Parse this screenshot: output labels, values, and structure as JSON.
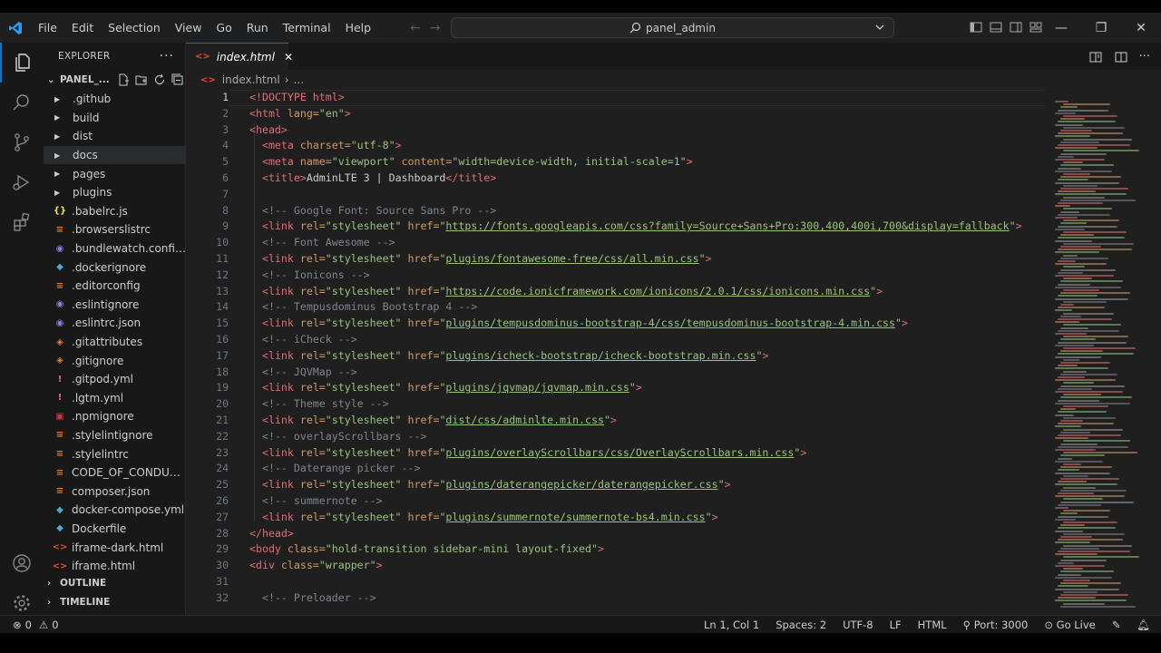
{
  "menu": [
    "File",
    "Edit",
    "Selection",
    "View",
    "Go",
    "Run",
    "Terminal",
    "Help"
  ],
  "command_center": {
    "text": "panel_admin",
    "icon": "search-icon"
  },
  "explorer": {
    "header": "EXPLORER",
    "folder_name": "PANEL_...",
    "items": [
      {
        "name": ".github",
        "kind": "dir"
      },
      {
        "name": "build",
        "kind": "dir"
      },
      {
        "name": "dist",
        "kind": "dir"
      },
      {
        "name": "docs",
        "kind": "dir"
      },
      {
        "name": "pages",
        "kind": "dir"
      },
      {
        "name": "plugins",
        "kind": "dir"
      },
      {
        "name": ".babelrc.js",
        "kind": "file",
        "icon": "{}",
        "color": "#f1e05a"
      },
      {
        "name": ".browserslistrc",
        "kind": "file",
        "icon": "≡",
        "color": "#e37933"
      },
      {
        "name": ".bundlewatch.config.j...",
        "kind": "file",
        "icon": "◉",
        "color": "#8f7ce0"
      },
      {
        "name": ".dockerignore",
        "kind": "file",
        "icon": "◆",
        "color": "#4aa8d8"
      },
      {
        "name": ".editorconfig",
        "kind": "file",
        "icon": "≡",
        "color": "#e37933"
      },
      {
        "name": ".eslintignore",
        "kind": "file",
        "icon": "◉",
        "color": "#8f7ce0"
      },
      {
        "name": ".eslintrc.json",
        "kind": "file",
        "icon": "◉",
        "color": "#8f7ce0"
      },
      {
        "name": ".gitattributes",
        "kind": "file",
        "icon": "◈",
        "color": "#e37933"
      },
      {
        "name": ".gitignore",
        "kind": "file",
        "icon": "◈",
        "color": "#e37933"
      },
      {
        "name": ".gitpod.yml",
        "kind": "file",
        "icon": "!",
        "color": "#e06c75"
      },
      {
        "name": ".lgtm.yml",
        "kind": "file",
        "icon": "!",
        "color": "#e06c75"
      },
      {
        "name": ".npmignore",
        "kind": "file",
        "icon": "▣",
        "color": "#cb3837"
      },
      {
        "name": ".stylelintignore",
        "kind": "file",
        "icon": "≡",
        "color": "#e37933"
      },
      {
        "name": ".stylelintrc",
        "kind": "file",
        "icon": "≡",
        "color": "#e37933"
      },
      {
        "name": "CODE_OF_CONDUCT....",
        "kind": "file",
        "icon": "≡",
        "color": "#e37933"
      },
      {
        "name": "composer.json",
        "kind": "file",
        "icon": "≡",
        "color": "#e37933"
      },
      {
        "name": "docker-compose.yml",
        "kind": "file",
        "icon": "◆",
        "color": "#4aa8d8"
      },
      {
        "name": "Dockerfile",
        "kind": "file",
        "icon": "◆",
        "color": "#4aa8d8"
      },
      {
        "name": "iframe-dark.html",
        "kind": "file",
        "icon": "<>",
        "color": "#e44d26"
      },
      {
        "name": "iframe.html",
        "kind": "file",
        "icon": "<>",
        "color": "#e44d26"
      }
    ],
    "outline_label": "OUTLINE",
    "timeline_label": "TIMELINE"
  },
  "tab": {
    "label": "index.html",
    "icon": "html-file-icon"
  },
  "breadcrumb": {
    "file": "index.html",
    "rest": "..."
  },
  "code": [
    [
      [
        "t",
        "<!DOCTYPE html>"
      ]
    ],
    [
      [
        "t",
        "<html "
      ],
      [
        "a",
        "lang="
      ],
      [
        "s",
        "\"en\""
      ],
      [
        "t",
        ">"
      ]
    ],
    [
      [
        "t",
        "<head>"
      ]
    ],
    [
      [
        "p",
        "  "
      ],
      [
        "t",
        "<meta "
      ],
      [
        "a",
        "charset="
      ],
      [
        "s",
        "\"utf-8\""
      ],
      [
        "t",
        ">"
      ]
    ],
    [
      [
        "p",
        "  "
      ],
      [
        "t",
        "<meta "
      ],
      [
        "a",
        "name="
      ],
      [
        "s",
        "\"viewport\" "
      ],
      [
        "a",
        "content="
      ],
      [
        "s",
        "\"width=device-width, initial-scale=1\""
      ],
      [
        "t",
        ">"
      ]
    ],
    [
      [
        "p",
        "  "
      ],
      [
        "t",
        "<title>"
      ],
      [
        "p",
        "AdminLTE 3 | Dashboard"
      ],
      [
        "t",
        "</title>"
      ]
    ],
    [
      [
        "p",
        ""
      ]
    ],
    [
      [
        "p",
        "  "
      ],
      [
        "cm",
        "<!-- Google Font: Source Sans Pro -->"
      ]
    ],
    [
      [
        "p",
        "  "
      ],
      [
        "t",
        "<link "
      ],
      [
        "a",
        "rel="
      ],
      [
        "s",
        "\"stylesheet\" "
      ],
      [
        "a",
        "href="
      ],
      [
        "s",
        "\""
      ],
      [
        "u",
        "https://fonts.googleapis.com/css?family=Source+Sans+Pro:300,400,400i,700&display=fallback"
      ],
      [
        "s",
        "\""
      ],
      [
        "t",
        ">"
      ]
    ],
    [
      [
        "p",
        "  "
      ],
      [
        "cm",
        "<!-- Font Awesome -->"
      ]
    ],
    [
      [
        "p",
        "  "
      ],
      [
        "t",
        "<link "
      ],
      [
        "a",
        "rel="
      ],
      [
        "s",
        "\"stylesheet\" "
      ],
      [
        "a",
        "href="
      ],
      [
        "s",
        "\""
      ],
      [
        "u",
        "plugins/fontawesome-free/css/all.min.css"
      ],
      [
        "s",
        "\""
      ],
      [
        "t",
        ">"
      ]
    ],
    [
      [
        "p",
        "  "
      ],
      [
        "cm",
        "<!-- Ionicons -->"
      ]
    ],
    [
      [
        "p",
        "  "
      ],
      [
        "t",
        "<link "
      ],
      [
        "a",
        "rel="
      ],
      [
        "s",
        "\"stylesheet\" "
      ],
      [
        "a",
        "href="
      ],
      [
        "s",
        "\""
      ],
      [
        "u",
        "https://code.ionicframework.com/ionicons/2.0.1/css/ionicons.min.css"
      ],
      [
        "s",
        "\""
      ],
      [
        "t",
        ">"
      ]
    ],
    [
      [
        "p",
        "  "
      ],
      [
        "cm",
        "<!-- Tempusdominus Bootstrap 4 -->"
      ]
    ],
    [
      [
        "p",
        "  "
      ],
      [
        "t",
        "<link "
      ],
      [
        "a",
        "rel="
      ],
      [
        "s",
        "\"stylesheet\" "
      ],
      [
        "a",
        "href="
      ],
      [
        "s",
        "\""
      ],
      [
        "u",
        "plugins/tempusdominus-bootstrap-4/css/tempusdominus-bootstrap-4.min.css"
      ],
      [
        "s",
        "\""
      ],
      [
        "t",
        ">"
      ]
    ],
    [
      [
        "p",
        "  "
      ],
      [
        "cm",
        "<!-- iCheck -->"
      ]
    ],
    [
      [
        "p",
        "  "
      ],
      [
        "t",
        "<link "
      ],
      [
        "a",
        "rel="
      ],
      [
        "s",
        "\"stylesheet\" "
      ],
      [
        "a",
        "href="
      ],
      [
        "s",
        "\""
      ],
      [
        "u",
        "plugins/icheck-bootstrap/icheck-bootstrap.min.css"
      ],
      [
        "s",
        "\""
      ],
      [
        "t",
        ">"
      ]
    ],
    [
      [
        "p",
        "  "
      ],
      [
        "cm",
        "<!-- JQVMap -->"
      ]
    ],
    [
      [
        "p",
        "  "
      ],
      [
        "t",
        "<link "
      ],
      [
        "a",
        "rel="
      ],
      [
        "s",
        "\"stylesheet\" "
      ],
      [
        "a",
        "href="
      ],
      [
        "s",
        "\""
      ],
      [
        "u",
        "plugins/jqvmap/jqvmap.min.css"
      ],
      [
        "s",
        "\""
      ],
      [
        "t",
        ">"
      ]
    ],
    [
      [
        "p",
        "  "
      ],
      [
        "cm",
        "<!-- Theme style -->"
      ]
    ],
    [
      [
        "p",
        "  "
      ],
      [
        "t",
        "<link "
      ],
      [
        "a",
        "rel="
      ],
      [
        "s",
        "\"stylesheet\" "
      ],
      [
        "a",
        "href="
      ],
      [
        "s",
        "\""
      ],
      [
        "u",
        "dist/css/adminlte.min.css"
      ],
      [
        "s",
        "\""
      ],
      [
        "t",
        ">"
      ]
    ],
    [
      [
        "p",
        "  "
      ],
      [
        "cm",
        "<!-- overlayScrollbars -->"
      ]
    ],
    [
      [
        "p",
        "  "
      ],
      [
        "t",
        "<link "
      ],
      [
        "a",
        "rel="
      ],
      [
        "s",
        "\"stylesheet\" "
      ],
      [
        "a",
        "href="
      ],
      [
        "s",
        "\""
      ],
      [
        "u",
        "plugins/overlayScrollbars/css/OverlayScrollbars.min.css"
      ],
      [
        "s",
        "\""
      ],
      [
        "t",
        ">"
      ]
    ],
    [
      [
        "p",
        "  "
      ],
      [
        "cm",
        "<!-- Daterange picker -->"
      ]
    ],
    [
      [
        "p",
        "  "
      ],
      [
        "t",
        "<link "
      ],
      [
        "a",
        "rel="
      ],
      [
        "s",
        "\"stylesheet\" "
      ],
      [
        "a",
        "href="
      ],
      [
        "s",
        "\""
      ],
      [
        "u",
        "plugins/daterangepicker/daterangepicker.css"
      ],
      [
        "s",
        "\""
      ],
      [
        "t",
        ">"
      ]
    ],
    [
      [
        "p",
        "  "
      ],
      [
        "cm",
        "<!-- summernote -->"
      ]
    ],
    [
      [
        "p",
        "  "
      ],
      [
        "t",
        "<link "
      ],
      [
        "a",
        "rel="
      ],
      [
        "s",
        "\"stylesheet\" "
      ],
      [
        "a",
        "href="
      ],
      [
        "s",
        "\""
      ],
      [
        "u",
        "plugins/summernote/summernote-bs4.min.css"
      ],
      [
        "s",
        "\""
      ],
      [
        "t",
        ">"
      ]
    ],
    [
      [
        "t",
        "</head>"
      ]
    ],
    [
      [
        "t",
        "<body "
      ],
      [
        "a",
        "class="
      ],
      [
        "s",
        "\"hold-transition sidebar-mini layout-fixed\""
      ],
      [
        "t",
        ">"
      ]
    ],
    [
      [
        "t",
        "<div "
      ],
      [
        "a",
        "class="
      ],
      [
        "s",
        "\"wrapper\""
      ],
      [
        "t",
        ">"
      ]
    ],
    [
      [
        "p",
        ""
      ]
    ],
    [
      [
        "p",
        "  "
      ],
      [
        "cm",
        "<!-- Preloader -->"
      ]
    ]
  ],
  "status": {
    "errors": "0",
    "warnings": "0",
    "cursor": "Ln 1, Col 1",
    "spaces": "Spaces: 2",
    "encoding": "UTF-8",
    "eol": "LF",
    "language": "HTML",
    "port": "Port: 3000",
    "golive": "Go Live"
  },
  "colors": {
    "accent": "#0078d4",
    "tag": "#e06c75",
    "attr": "#d19a66",
    "string": "#98c379",
    "comment": "#7f848e"
  }
}
